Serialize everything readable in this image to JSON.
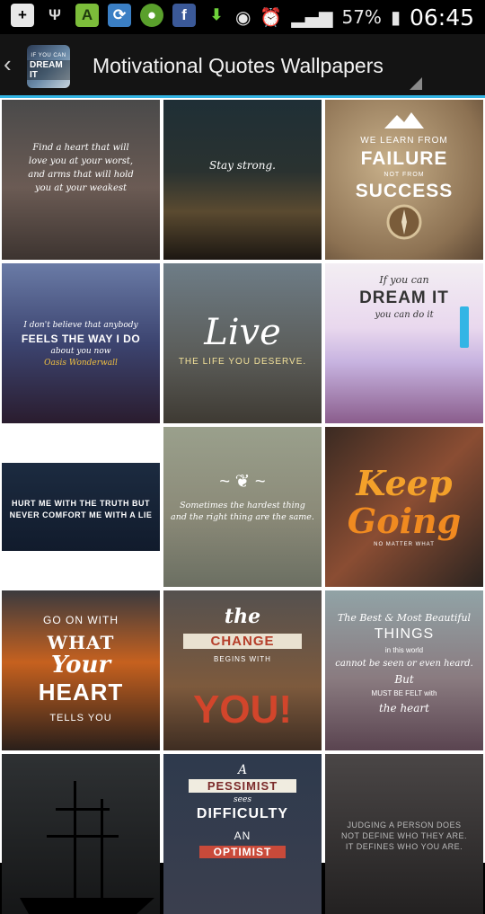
{
  "status_bar": {
    "battery": "57%",
    "time": "06:45"
  },
  "action_bar": {
    "title": "Motivational Quotes Wallpapers",
    "logo_small": "IF YOU CAN",
    "logo_text": "DREAM IT"
  },
  "tiles": {
    "t1": [
      "Find a heart that will",
      "love you at your worst,",
      "and arms that will hold",
      "you at your weakest"
    ],
    "t2": "Stay strong.",
    "t3": [
      "WE LEARN FROM",
      "FAILURE",
      "NOT FROM",
      "SUCCESS"
    ],
    "t4": [
      "I don't believe that anybody",
      "FEELS THE WAY I DO",
      "about you now",
      "Oasis Wonderwall"
    ],
    "t5": [
      "Live",
      "THE LIFE YOU DESERVE."
    ],
    "t6": [
      "If you can",
      "DREAM IT",
      "you can do it"
    ],
    "t7": [
      "HURT ME WITH THE TRUTH BUT",
      "NEVER COMFORT ME WITH A LIE"
    ],
    "t8": [
      "Sometimes the hardest thing",
      "and the right thing are the same."
    ],
    "t9": [
      "Keep",
      "Going",
      "NO MATTER WHAT"
    ],
    "t10": [
      "GO ON WITH",
      "WHAT",
      "Your",
      "HEART",
      "TELLS YOU"
    ],
    "t11": [
      "the",
      "CHANGE",
      "BEGINS WITH",
      "YOU!"
    ],
    "t12": [
      "The Best & Most Beautiful",
      "THINGS",
      "in this world",
      "cannot be seen or even heard.",
      "But",
      "MUST BE FELT with",
      "the heart"
    ],
    "t14": [
      "A",
      "PESSIMIST",
      "sees",
      "DIFFICULTY",
      "AN",
      "OPTIMIST"
    ],
    "t15": [
      "JUDGING A PERSON DOES",
      "NOT DEFINE WHO THEY ARE.",
      "IT DEFINES WHO YOU ARE."
    ]
  },
  "colors": {
    "accent": "#33b5e5",
    "actionbar": "#141414"
  }
}
